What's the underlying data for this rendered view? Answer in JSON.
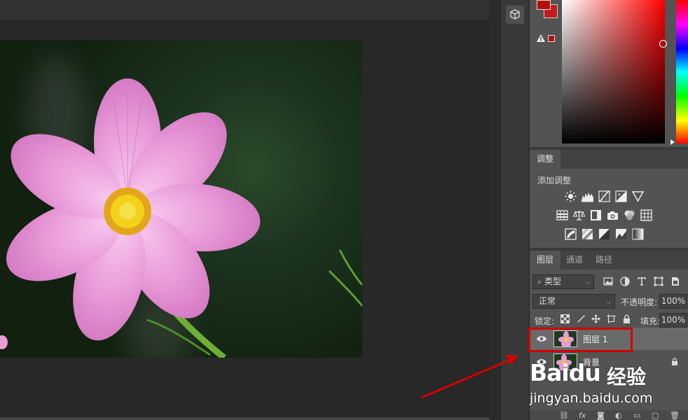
{
  "color_panel": {
    "foreground_color": "#b40e0e",
    "background_color": "#c41c1c"
  },
  "adjustments": {
    "tab_label": "调整",
    "add_label": "添加调整",
    "row1_icons": [
      "brightness-contrast-icon",
      "levels-icon",
      "curves-icon",
      "exposure-icon",
      "vibrance-icon"
    ],
    "row2_icons": [
      "hue-saturation-icon",
      "color-balance-icon",
      "black-white-icon",
      "photo-filter-icon",
      "channel-mixer-icon",
      "color-lookup-icon"
    ],
    "row3_icons": [
      "invert-icon",
      "posterize-icon",
      "threshold-icon",
      "selective-color-icon",
      "gradient-map-icon"
    ]
  },
  "layers": {
    "tabs": [
      {
        "label": "图层",
        "active": true
      },
      {
        "label": "通道",
        "active": false
      },
      {
        "label": "路径",
        "active": false
      }
    ],
    "kind_filter": "类型",
    "blend_mode": "正常",
    "opacity_label": "不透明度:",
    "opacity_value": "100%",
    "lock_label": "锁定:",
    "fill_label": "填充:",
    "fill_value": "100%",
    "items": [
      {
        "name": "图层 1",
        "visible": true,
        "selected": true
      },
      {
        "name": "背景",
        "visible": true,
        "selected": false,
        "locked": true
      }
    ]
  },
  "annotation": {
    "highlight_color": "#d00000"
  },
  "watermark": {
    "logo": "Baidu",
    "brand": "经验",
    "url": "jingyan.baidu.com"
  }
}
